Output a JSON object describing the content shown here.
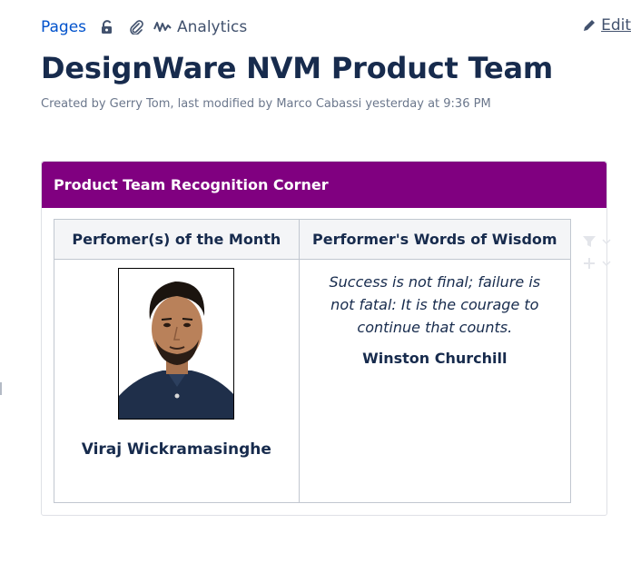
{
  "toolbar": {
    "pages_label": "Pages",
    "analytics_label": "Analytics",
    "edit_label": "Edit",
    "icons": [
      "lock-icon",
      "paperclip-icon",
      "analytics-icon",
      "pencil-icon"
    ]
  },
  "page": {
    "title": "DesignWare NVM Product Team",
    "byline": "Created by Gerry Tom, last modified by Marco Cabassi yesterday at 9:36 PM"
  },
  "panel": {
    "header": "Product Team Recognition Corner",
    "header_color": "#800080",
    "table": {
      "headers": [
        "Perfomer(s) of the Month",
        "Performer's Words of Wisdom"
      ],
      "performer_name": "Viraj Wickramasinghe",
      "quote": "Success is not final; failure is not fatal: It is the courage to continue that counts.",
      "quote_author": "Winston Churchill"
    }
  },
  "colors": {
    "link": "#0052cc",
    "text": "#172b4d",
    "muted": "#6b778c"
  }
}
